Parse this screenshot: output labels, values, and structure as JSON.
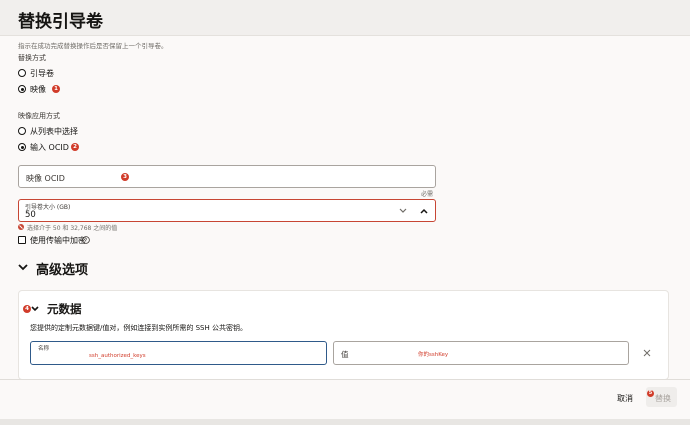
{
  "header": {
    "title": "替换引导卷"
  },
  "intro": {
    "hint": "指示在成功完成替换操作后是否保留上一个引导卷。"
  },
  "replace_method": {
    "label": "替换方式",
    "options": [
      {
        "label": "引导卷",
        "checked": false
      },
      {
        "label": "映像",
        "checked": true,
        "badge": "1"
      }
    ]
  },
  "apply_method": {
    "label": "映像应用方式",
    "options": [
      {
        "label": "从列表中选择",
        "checked": false
      },
      {
        "label": "输入 OCID",
        "checked": true,
        "badge": "2"
      }
    ]
  },
  "image_ocid": {
    "placeholder": "映像 OCID",
    "badge": "3",
    "required": "必需"
  },
  "boot_volume_size": {
    "label": "引导卷大小 (GB)",
    "value": "50",
    "error": "选择介于 50 和 32,768 之间的值"
  },
  "encryption": {
    "label": "使用传输中加密",
    "checked": false
  },
  "advanced": {
    "title": "高级选项"
  },
  "metadata": {
    "badge": "4",
    "title": "元数据",
    "description": "您提供的定制元数据键/值对，例如连接到实例所需的 SSH 公共密钥。",
    "name_label": "名称",
    "name_value": "ssh_authorized_keys",
    "value_label": "值",
    "value_value": "你的sshKey"
  },
  "footer": {
    "cancel": "取消",
    "replace": "替换",
    "badge": "5"
  },
  "colors": {
    "accent_error": "#c74634",
    "badge": "#d13c2a",
    "focus": "#2f5a8a"
  }
}
